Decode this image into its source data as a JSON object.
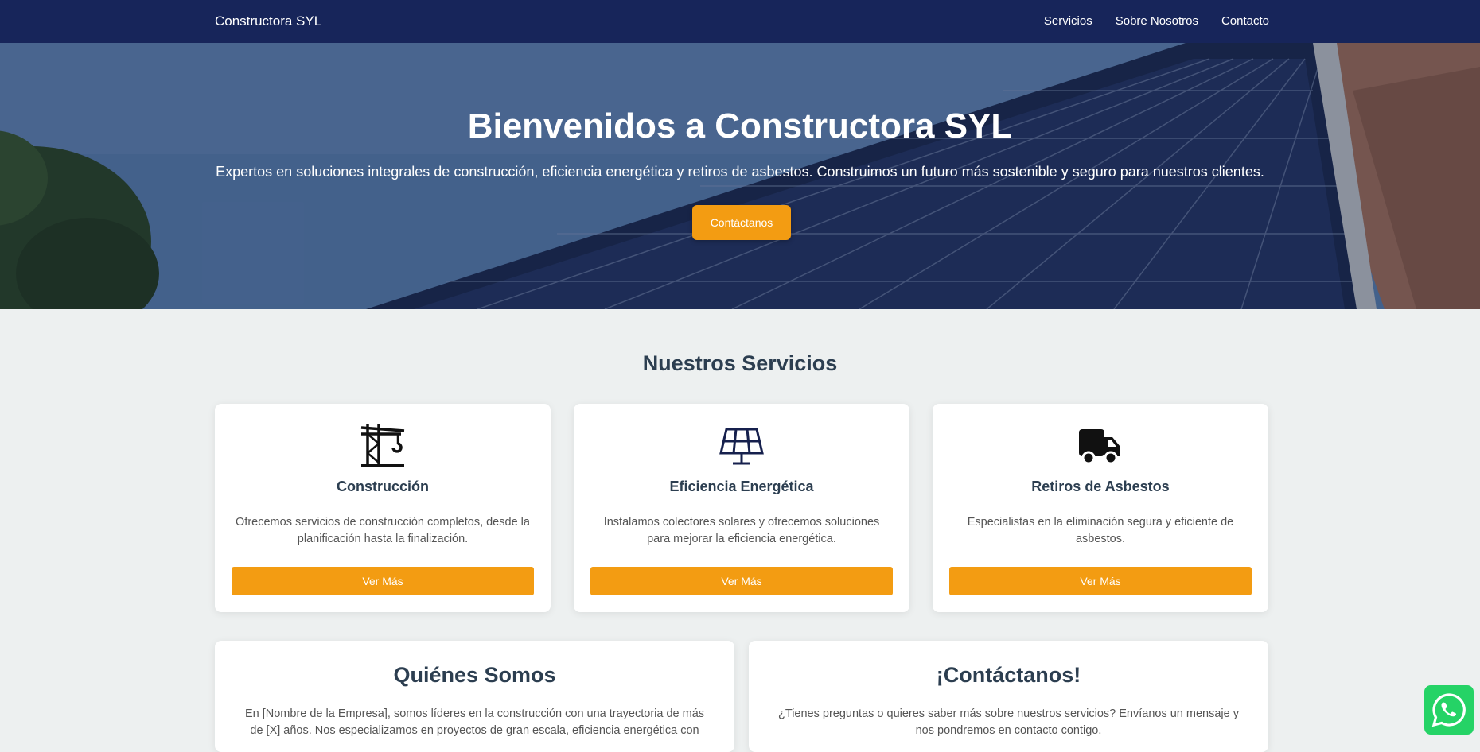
{
  "navbar": {
    "brand": "Constructora SYL",
    "links": [
      "Servicios",
      "Sobre Nosotros",
      "Contacto"
    ]
  },
  "hero": {
    "title": "Bienvenidos a Constructora SYL",
    "subtitle": "Expertos en soluciones integrales de construcción, eficiencia energética y retiros de asbestos. Construimos un futuro más sostenible y seguro para nuestros clientes.",
    "cta_label": "Contáctanos"
  },
  "services": {
    "title": "Nuestros Servicios",
    "items": [
      {
        "icon": "crane-icon",
        "title": "Construcción",
        "text": "Ofrecemos servicios de construcción completos, desde la planificación hasta la finalización.",
        "button_label": "Ver Más"
      },
      {
        "icon": "solar-panel-icon",
        "title": "Eficiencia Energética",
        "text": "Instalamos colectores solares y ofrecemos soluciones para mejorar la eficiencia energética.",
        "button_label": "Ver Más"
      },
      {
        "icon": "truck-icon",
        "title": "Retiros de Asbestos",
        "text": "Especialistas en la eliminación segura y eficiente de asbestos.",
        "button_label": "Ver Más"
      }
    ]
  },
  "about": {
    "title": "Quiénes Somos",
    "text": "En [Nombre de la Empresa], somos líderes en la construcción con una trayectoria de más de [X] años. Nos especializamos en proyectos de gran escala, eficiencia energética con"
  },
  "contact": {
    "title": "¡Contáctanos!",
    "text": "¿Tienes preguntas o quieres saber más sobre nuestros servicios? Envíanos un mensaje y nos pondremos en contacto contigo."
  },
  "whatsapp": {
    "icon": "whatsapp-icon"
  },
  "colors": {
    "navbar": "#17255a",
    "accent": "#f39c12",
    "background": "#edf0f0",
    "heading": "#2c3e50",
    "whatsapp": "#25d366"
  }
}
